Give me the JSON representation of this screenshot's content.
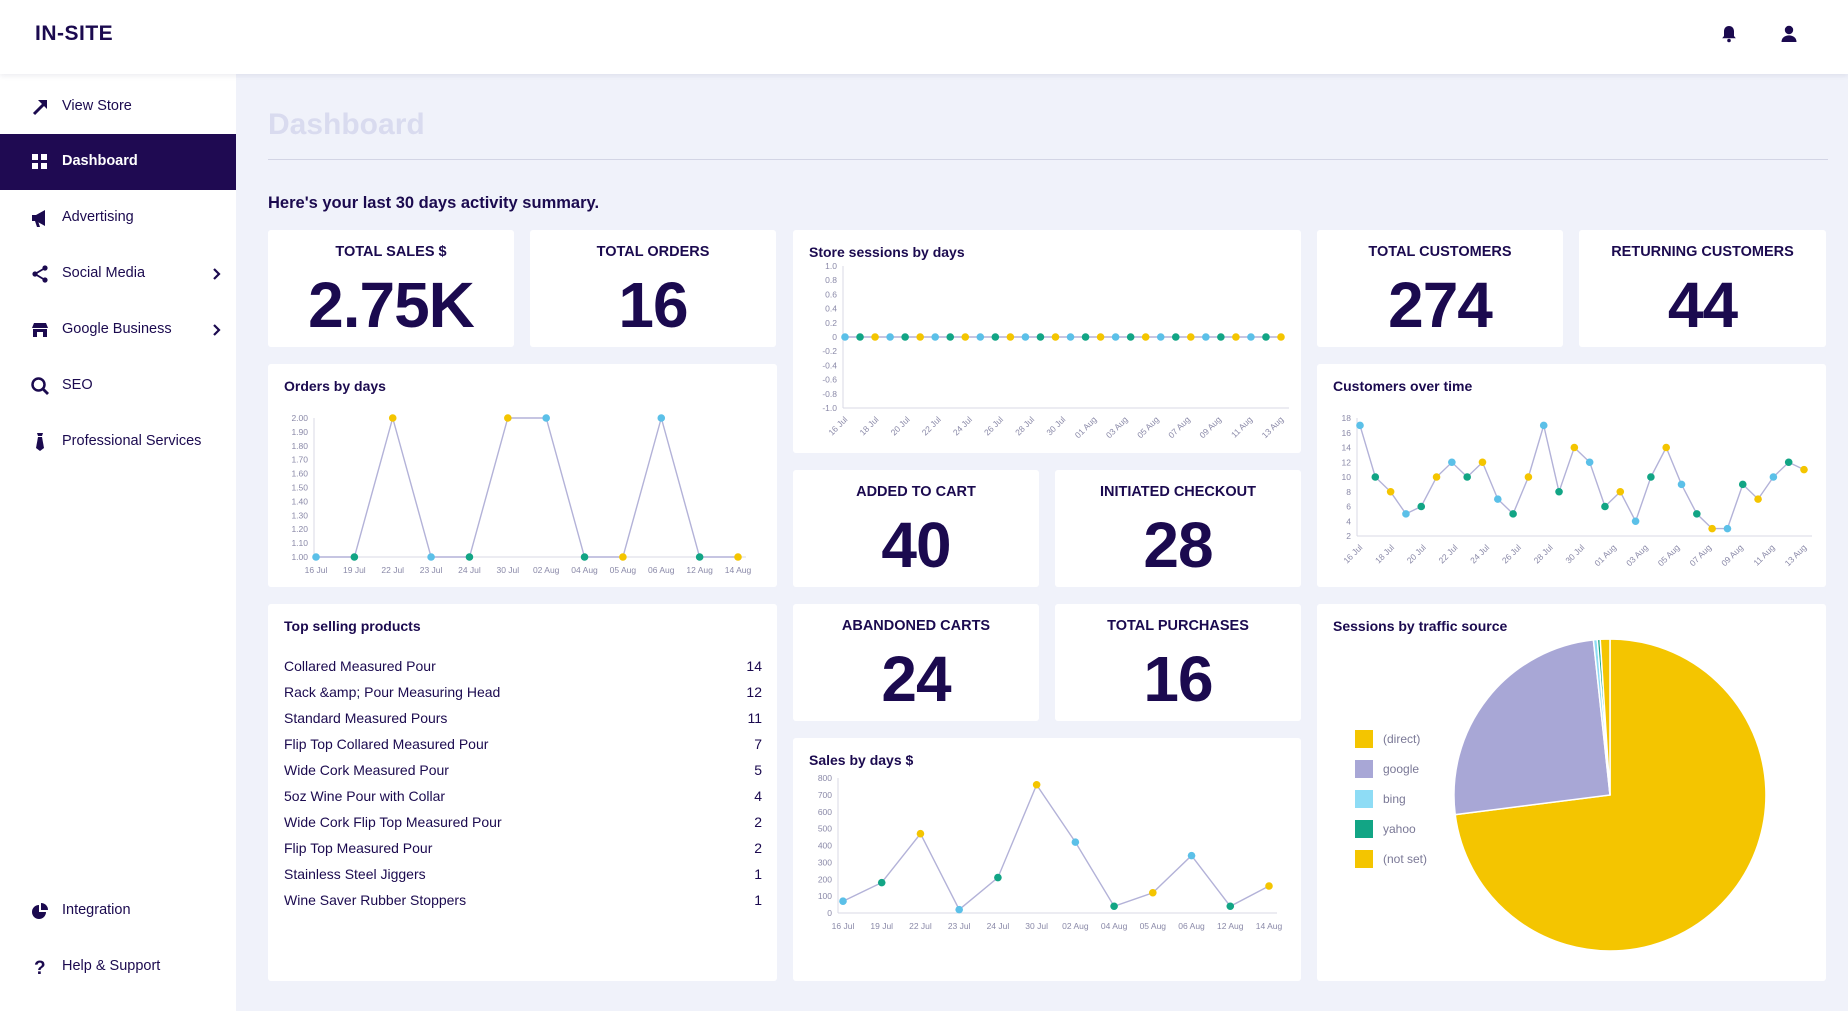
{
  "app": {
    "logo": "IN-SITE"
  },
  "topbar": {
    "icons": [
      "bell-icon",
      "user-icon"
    ]
  },
  "sidebar": {
    "items": [
      {
        "label": "View Store",
        "icon": "external-arrow-icon",
        "active": false,
        "chevron": false
      },
      {
        "label": "Dashboard",
        "icon": "grid-icon",
        "active": true,
        "chevron": false
      },
      {
        "label": "Advertising",
        "icon": "megaphone-icon",
        "active": false,
        "chevron": false
      },
      {
        "label": "Social Media",
        "icon": "share-icon",
        "active": false,
        "chevron": true
      },
      {
        "label": "Google Business",
        "icon": "store-icon",
        "active": false,
        "chevron": true
      },
      {
        "label": "SEO",
        "icon": "search-icon",
        "active": false,
        "chevron": false
      },
      {
        "label": "Professional Services",
        "icon": "tie-icon",
        "active": false,
        "chevron": false
      }
    ],
    "bottom": [
      {
        "label": "Integration",
        "icon": "plug-icon"
      },
      {
        "label": "Help & Support",
        "icon": "question-icon"
      }
    ]
  },
  "main": {
    "title": "Dashboard",
    "summary": "Here's your last 30 days activity summary."
  },
  "kpis": {
    "total_sales": {
      "label": "TOTAL SALES $",
      "value": "2.75K"
    },
    "total_orders": {
      "label": "TOTAL ORDERS",
      "value": "16"
    },
    "total_customers": {
      "label": "TOTAL CUSTOMERS",
      "value": "274"
    },
    "returning_customers": {
      "label": "RETURNING CUSTOMERS",
      "value": "44"
    },
    "added_to_cart": {
      "label": "ADDED TO CART",
      "value": "40"
    },
    "initiated_checkout": {
      "label": "INITIATED CHECKOUT",
      "value": "28"
    },
    "abandoned_carts": {
      "label": "ABANDONED CARTS",
      "value": "24"
    },
    "total_purchases": {
      "label": "TOTAL PURCHASES",
      "value": "16"
    }
  },
  "top_products": {
    "title": "Top selling products",
    "items": [
      {
        "name": "Collared Measured Pour",
        "count": "14"
      },
      {
        "name": "Rack &amp; Pour Measuring Head",
        "count": "12"
      },
      {
        "name": "Standard Measured Pours",
        "count": "11"
      },
      {
        "name": "Flip Top Collared Measured Pour",
        "count": "7"
      },
      {
        "name": "Wide Cork Measured Pour",
        "count": "5"
      },
      {
        "name": "5oz Wine Pour with Collar",
        "count": "4"
      },
      {
        "name": "Wide Cork Flip Top Measured Pour",
        "count": "2"
      },
      {
        "name": "Flip Top Measured Pour",
        "count": "2"
      },
      {
        "name": "Stainless Steel Jiggers",
        "count": "1"
      },
      {
        "name": "Wine Saver Rubber Stoppers",
        "count": "1"
      }
    ]
  },
  "colors": {
    "navy": "#1f0a52",
    "point_palette": [
      "#5bc0e8",
      "#12a585",
      "#f4c500"
    ],
    "line": "#b3b2d8"
  },
  "chart_data": [
    {
      "id": "orders",
      "type": "line",
      "title": "Orders by days",
      "x": [
        "16 Jul",
        "19 Jul",
        "22 Jul",
        "23 Jul",
        "24 Jul",
        "30 Jul",
        "02 Aug",
        "04 Aug",
        "05 Aug",
        "06 Aug",
        "12 Aug",
        "14 Aug"
      ],
      "values": [
        1,
        1,
        2,
        1,
        1,
        2,
        2,
        1,
        1,
        2,
        1,
        1
      ],
      "yticks": [
        "2.00",
        "1.90",
        "1.80",
        "1.70",
        "1.60",
        "1.50",
        "1.40",
        "1.30",
        "1.20",
        "1.10",
        "1.00"
      ],
      "ylim": [
        1,
        2
      ],
      "point_colors": [
        0,
        1,
        2,
        0,
        1,
        2,
        0,
        1,
        2,
        0,
        1,
        2
      ]
    },
    {
      "id": "sessions",
      "type": "line",
      "title": "Store sessions by days",
      "x": [
        "16 Jul",
        "18 Jul",
        "20 Jul",
        "22 Jul",
        "24 Jul",
        "26 Jul",
        "28 Jul",
        "30 Jul",
        "01 Aug",
        "03 Aug",
        "05 Aug",
        "07 Aug",
        "09 Aug",
        "11 Aug",
        "13 Aug"
      ],
      "point_count": 30,
      "values_all": 0,
      "yticks": [
        "1.0",
        "0.8",
        "0.6",
        "0.4",
        "0.2",
        "0",
        "-0.2",
        "-0.4",
        "-0.6",
        "-0.8",
        "-1.0"
      ],
      "ylim": [
        -1,
        1
      ]
    },
    {
      "id": "customers",
      "type": "line",
      "title": "Customers over time",
      "x": [
        "16 Jul",
        "18 Jul",
        "20 Jul",
        "22 Jul",
        "24 Jul",
        "26 Jul",
        "28 Jul",
        "30 Jul",
        "01 Aug",
        "03 Aug",
        "05 Aug",
        "07 Aug",
        "09 Aug",
        "11 Aug",
        "13 Aug"
      ],
      "values": [
        17,
        10,
        8,
        5,
        6,
        10,
        12,
        10,
        12,
        7,
        5,
        10,
        17,
        8,
        14,
        12,
        6,
        8,
        4,
        10,
        14,
        9,
        5,
        3,
        3,
        9,
        7,
        10,
        12,
        11
      ],
      "yticks": [
        "18",
        "16",
        "14",
        "12",
        "10",
        "8",
        "6",
        "4",
        "2"
      ],
      "ylim": [
        2,
        18
      ]
    },
    {
      "id": "sales",
      "type": "line",
      "title": "Sales by days $",
      "x": [
        "16 Jul",
        "19 Jul",
        "22 Jul",
        "23 Jul",
        "24 Jul",
        "30 Jul",
        "02 Aug",
        "04 Aug",
        "05 Aug",
        "06 Aug",
        "12 Aug",
        "14 Aug"
      ],
      "values": [
        70,
        180,
        470,
        20,
        210,
        760,
        420,
        40,
        120,
        340,
        40,
        160
      ],
      "yticks": [
        "800",
        "700",
        "600",
        "500",
        "400",
        "300",
        "200",
        "100",
        "0"
      ],
      "ylim": [
        0,
        800
      ]
    },
    {
      "id": "traffic",
      "type": "pie",
      "title": "Sessions by traffic source",
      "slices": [
        {
          "label": "(direct)",
          "value": 73.0,
          "color": "#f4c500"
        },
        {
          "label": "google",
          "value": 25.3,
          "color": "#a8a7d6"
        },
        {
          "label": "bing",
          "value": 0.4,
          "color": "#8edcf5"
        },
        {
          "label": "yahoo",
          "value": 0.3,
          "color": "#12a585"
        },
        {
          "label": "(not set)",
          "value": 1.0,
          "color": "#f4c500"
        }
      ]
    }
  ]
}
